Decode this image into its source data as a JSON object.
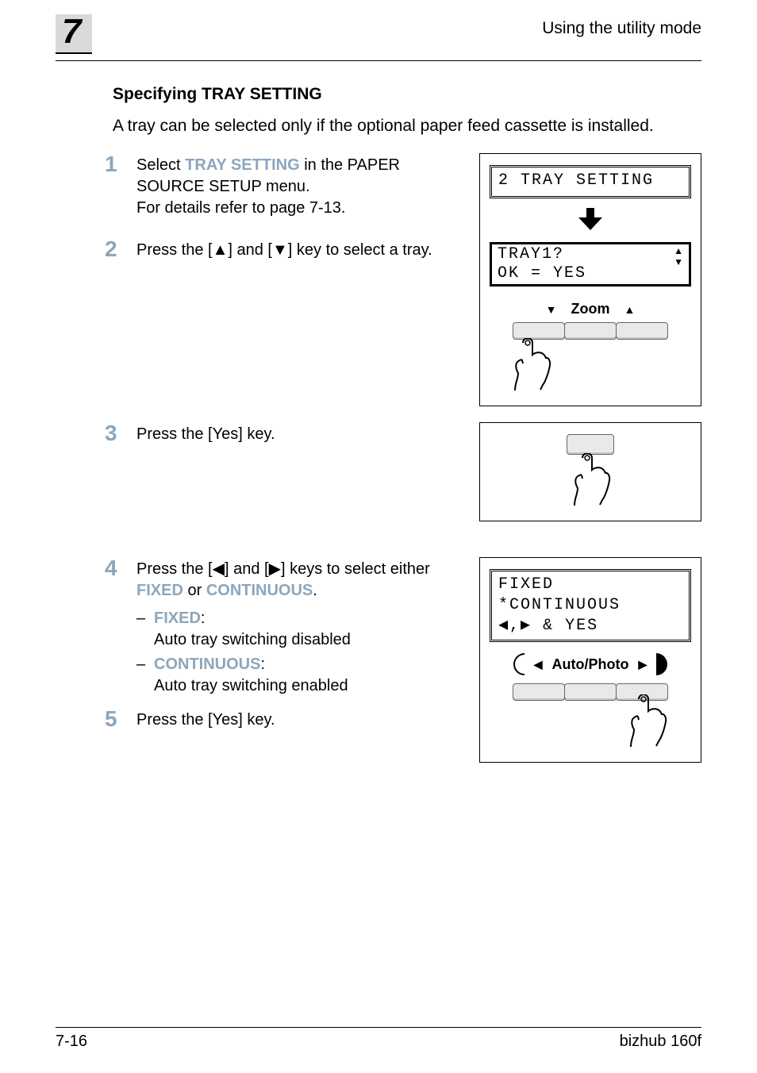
{
  "header": {
    "chapter": "7",
    "right": "Using the utility mode"
  },
  "section_title": "Specifying TRAY SETTING",
  "intro": "A tray can be selected only if the optional paper feed cassette is installed.",
  "steps": {
    "s1": {
      "num": "1",
      "pre": "Select ",
      "kw": "TRAY SETTING",
      "mid": " in the PAPER SOURCE SETUP menu.",
      "line2": "For details refer to page 7-13."
    },
    "s2": {
      "num": "2",
      "text": "Press the [▲] and [▼] key to select a tray."
    },
    "s3": {
      "num": "3",
      "text": "Press the [Yes] key."
    },
    "s4": {
      "num": "4",
      "pre": "Press the [◀] and [▶] keys to select either ",
      "kw1": "FIXED",
      "mid": " or ",
      "kw2": "CONTINUOUS",
      "post": ".",
      "f_label": "FIXED",
      "f_colon": ":",
      "f_desc": "Auto tray switching disabled",
      "c_label": "CONTINUOUS",
      "c_colon": ":",
      "c_desc": "Auto tray switching enabled"
    },
    "s5": {
      "num": "5",
      "text": "Press the [Yes] key."
    }
  },
  "panel1": {
    "lcd_top": "2 TRAY SETTING",
    "lcd_bottom_l1": "TRAY1?",
    "lcd_bottom_l2": " OK = YES",
    "zoom_label": "Zoom"
  },
  "panel3": {
    "lcd_l1": "FIXED  *CONTINUOUS",
    "lcd_l2_pre": " ◀,▶ & YES",
    "ap_label": "Auto/Photo"
  },
  "footer": {
    "left": "7-16",
    "right": "bizhub 160f"
  }
}
